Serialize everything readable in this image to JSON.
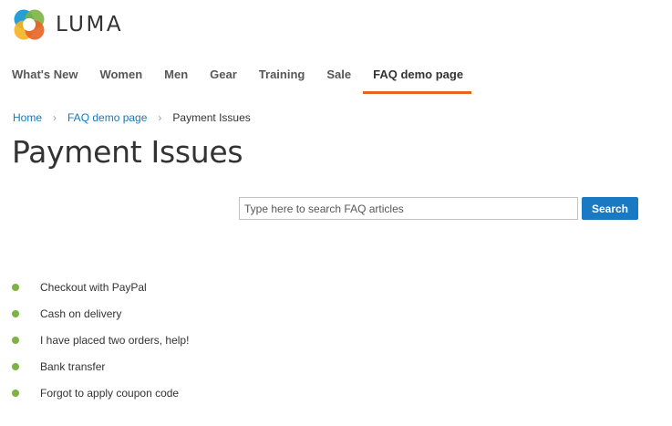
{
  "brand": {
    "name": "LUMA",
    "logo_icon": "luma-logo-icon",
    "colors": {
      "blue": "#1a9ad6",
      "green": "#7cb342",
      "orange": "#f26322",
      "red": "#e02b27"
    }
  },
  "nav": {
    "items": [
      {
        "label": "What's New",
        "active": false
      },
      {
        "label": "Women",
        "active": false
      },
      {
        "label": "Men",
        "active": false
      },
      {
        "label": "Gear",
        "active": false
      },
      {
        "label": "Training",
        "active": false
      },
      {
        "label": "Sale",
        "active": false
      },
      {
        "label": "FAQ demo page",
        "active": true
      }
    ],
    "active_underline_color": "#e86323"
  },
  "breadcrumb": {
    "items": [
      "Home",
      "FAQ demo page"
    ],
    "separator": "›",
    "current": "Payment Issues"
  },
  "page": {
    "title": "Payment Issues"
  },
  "search": {
    "placeholder": "Type here to search FAQ articles",
    "value": "",
    "button_label": "Search",
    "button_color": "#1979c3"
  },
  "faq": {
    "bullet_color": "#7cb342",
    "items": [
      "Checkout with PayPal",
      "Cash on delivery",
      "I have placed two orders, help!",
      "Bank transfer",
      "Forgot to apply coupon code"
    ]
  }
}
